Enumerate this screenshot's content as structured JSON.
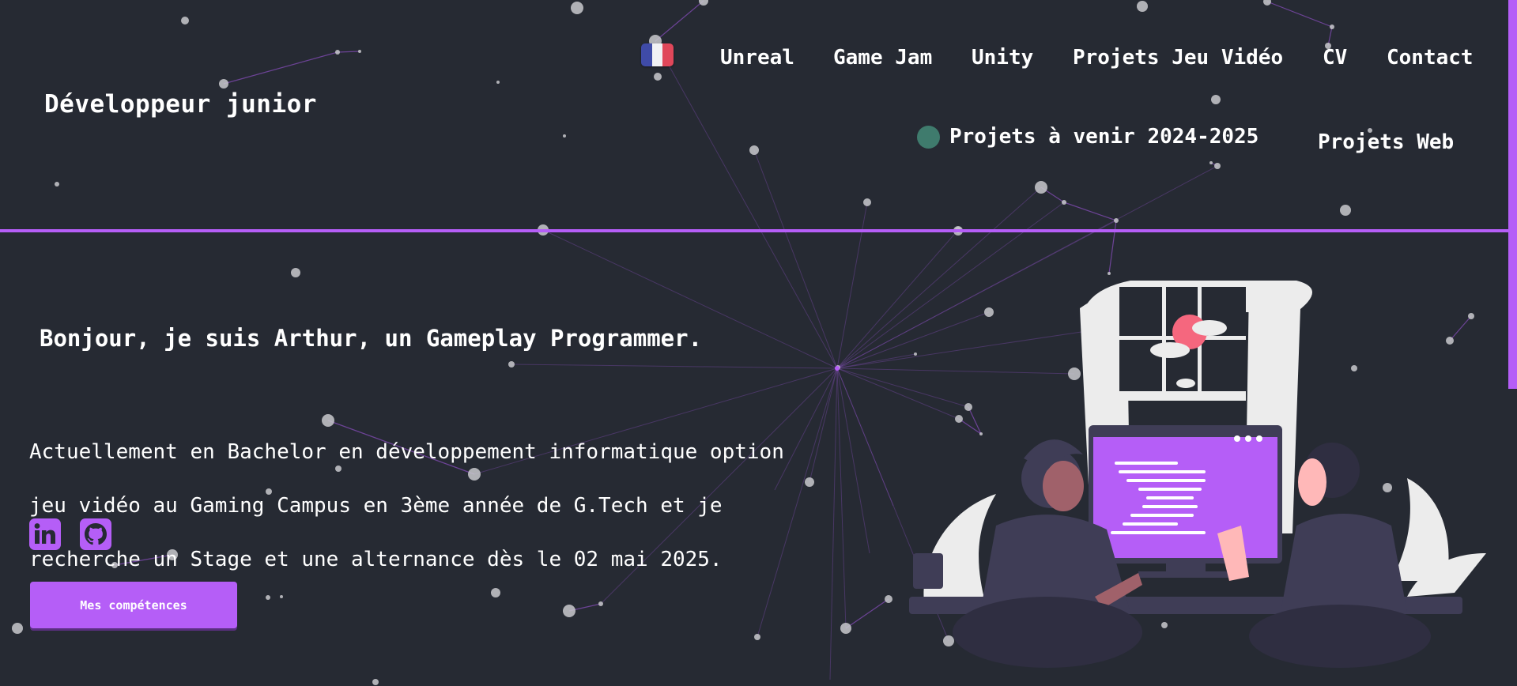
{
  "header": {
    "site_title": "Développeur junior",
    "flag_icon": "france-flag-icon",
    "nav": [
      "Unreal",
      "Game Jam",
      "Unity",
      "Projets Jeu Vidéo",
      "CV",
      "Contact"
    ],
    "upcoming_projects": "Projets à venir 2024-2025",
    "web_projects": "Projets Web"
  },
  "hero": {
    "greeting": "Bonjour, je suis Arthur, un Gameplay Programmer.",
    "intro_lines": [
      "Actuellement en Bachelor en développement informatique option",
      "jeu vidéo au Gaming Campus en 3ème année de G.Tech et je",
      "recherche un Stage et une alternance dès le 02 mai 2025."
    ],
    "social_icons": [
      "linkedin-icon",
      "github-icon"
    ],
    "skills_button": "Mes compétences"
  },
  "colors": {
    "background": "#262a33",
    "accent": "#b55ef7",
    "status_dot": "#3f7b6d"
  }
}
